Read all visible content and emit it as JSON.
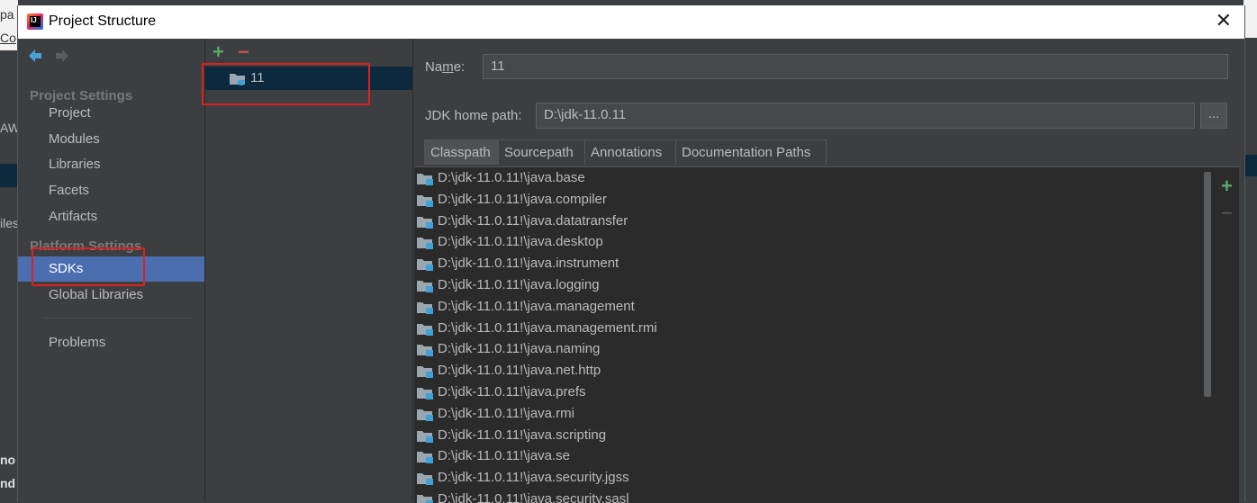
{
  "window": {
    "title": "Project Structure",
    "close": "✕"
  },
  "background": {
    "left_fragments": [
      "pa",
      "Co",
      "AW",
      "iles",
      "no",
      "nd"
    ]
  },
  "nav": {
    "back": "🡸",
    "forward": "🡺",
    "project_settings_title": "Project Settings",
    "project_items": [
      "Project",
      "Modules",
      "Libraries",
      "Facets",
      "Artifacts"
    ],
    "platform_settings_title": "Platform Settings",
    "platform_items": [
      "SDKs",
      "Global Libraries"
    ],
    "problems": "Problems",
    "selected": "SDKs"
  },
  "sdk_list": {
    "add": "+",
    "remove": "−",
    "items": [
      "11"
    ]
  },
  "detail": {
    "name_label_pre": "Na",
    "name_label_mnemonic": "m",
    "name_label_post": "e:",
    "name_value": "11",
    "jdk_home_label": "JDK home path:",
    "jdk_home_value": "D:\\jdk-11.0.11",
    "browse": "...",
    "tabs": [
      "Classpath",
      "Sourcepath",
      "Annotations",
      "Documentation Paths"
    ],
    "active_tab": "Classpath",
    "classpath": [
      "D:\\jdk-11.0.11!\\java.base",
      "D:\\jdk-11.0.11!\\java.compiler",
      "D:\\jdk-11.0.11!\\java.datatransfer",
      "D:\\jdk-11.0.11!\\java.desktop",
      "D:\\jdk-11.0.11!\\java.instrument",
      "D:\\jdk-11.0.11!\\java.logging",
      "D:\\jdk-11.0.11!\\java.management",
      "D:\\jdk-11.0.11!\\java.management.rmi",
      "D:\\jdk-11.0.11!\\java.naming",
      "D:\\jdk-11.0.11!\\java.net.http",
      "D:\\jdk-11.0.11!\\java.prefs",
      "D:\\jdk-11.0.11!\\java.rmi",
      "D:\\jdk-11.0.11!\\java.scripting",
      "D:\\jdk-11.0.11!\\java.se",
      "D:\\jdk-11.0.11!\\java.security.jgss",
      "D:\\jdk-11.0.11!\\java.security.sasl"
    ],
    "side_add": "+",
    "side_remove": "−"
  },
  "colors": {
    "accent_selection": "#4b6eaf",
    "tree_selection": "#0d293e",
    "annotation_red": "#e02020",
    "add_green": "#59a869",
    "remove_red": "#c75450"
  }
}
